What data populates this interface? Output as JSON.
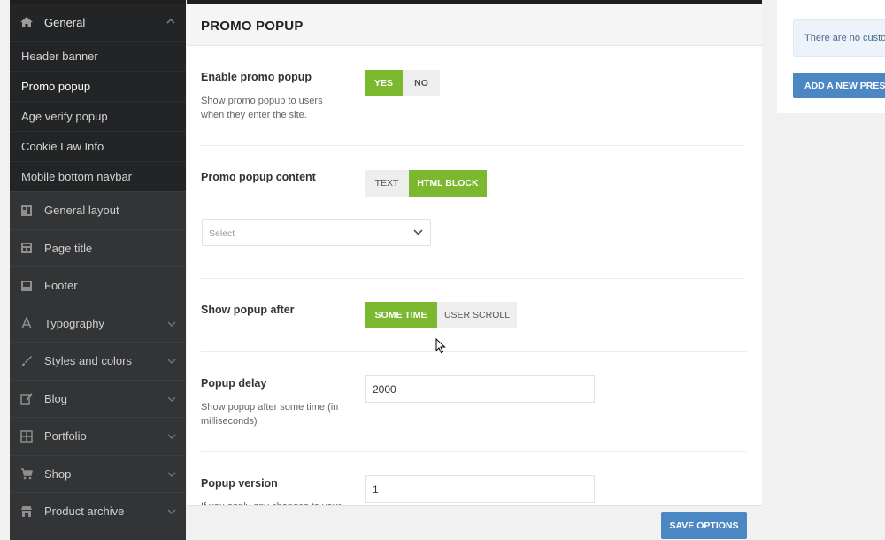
{
  "sidebar": {
    "head": {
      "label": "General",
      "icon": "home-icon"
    },
    "subitems": [
      {
        "label": "Header banner",
        "active": false
      },
      {
        "label": "Promo popup",
        "active": true
      },
      {
        "label": "Age verify popup",
        "active": false
      },
      {
        "label": "Cookie Law Info",
        "active": false
      },
      {
        "label": "Mobile bottom navbar",
        "active": false
      }
    ],
    "items": [
      {
        "label": "General layout",
        "icon": "layout-icon",
        "chevron": false
      },
      {
        "label": "Page title",
        "icon": "page-title-icon",
        "chevron": false
      },
      {
        "label": "Footer",
        "icon": "footer-icon",
        "chevron": false
      },
      {
        "label": "Typography",
        "icon": "typography-icon",
        "chevron": true
      },
      {
        "label": "Styles and colors",
        "icon": "brush-icon",
        "chevron": true
      },
      {
        "label": "Blog",
        "icon": "edit-icon",
        "chevron": true
      },
      {
        "label": "Portfolio",
        "icon": "grid-icon",
        "chevron": true
      },
      {
        "label": "Shop",
        "icon": "cart-icon",
        "chevron": true
      },
      {
        "label": "Product archive",
        "icon": "store-icon",
        "chevron": true
      }
    ]
  },
  "panel": {
    "title": "PROMO POPUP",
    "enable": {
      "label": "Enable promo popup",
      "desc": "Show promo popup to users when they enter the site.",
      "yes": "YES",
      "no": "NO",
      "selected": "YES"
    },
    "content": {
      "label": "Promo popup content",
      "text": "TEXT",
      "html_block": "HTML BLOCK",
      "selected": "HTML BLOCK",
      "select_placeholder": "Select"
    },
    "show_after": {
      "label": "Show popup after",
      "some_time": "SOME TIME",
      "user_scroll": "USER SCROLL",
      "selected": "SOME TIME"
    },
    "delay": {
      "label": "Popup delay",
      "desc": "Show popup after some time (in milliseconds)",
      "value": "2000"
    },
    "version": {
      "label": "Popup version",
      "desc": "If you apply any changes to your",
      "value": "1"
    },
    "save_label": "SAVE OPTIONS"
  },
  "presets": {
    "notice": "There are no custo",
    "add_label": "ADD A NEW PRESE"
  },
  "colors": {
    "accent_green": "#7cb82f",
    "accent_blue": "#4b87c3",
    "sidebar_bg": "#333436"
  }
}
